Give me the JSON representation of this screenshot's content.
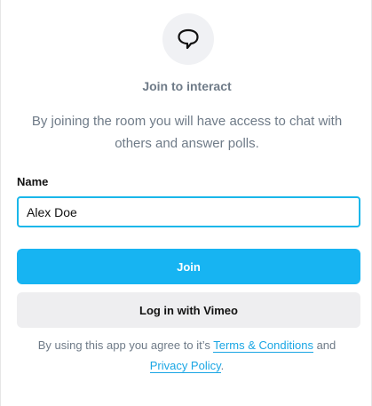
{
  "header": {
    "icon": "speech-bubble-icon",
    "title": "Join to interact",
    "description_line1": "By joining the room you will have access to chat with",
    "description_line2": "others and answer polls."
  },
  "form": {
    "name_label": "Name",
    "name_value": "Alex Doe",
    "join_label": "Join",
    "vimeo_label": "Log in with Vimeo"
  },
  "legal": {
    "prefix": "By using this app you agree to it’s ",
    "terms_link": "Terms & Conditions",
    "middle": " and",
    "privacy_link": "Privacy Policy",
    "suffix": "."
  },
  "colors": {
    "accent": "#17b4f2",
    "link": "#1aa6e4",
    "muted_text": "#6f7b88",
    "secondary_button": "#eeeef0"
  }
}
